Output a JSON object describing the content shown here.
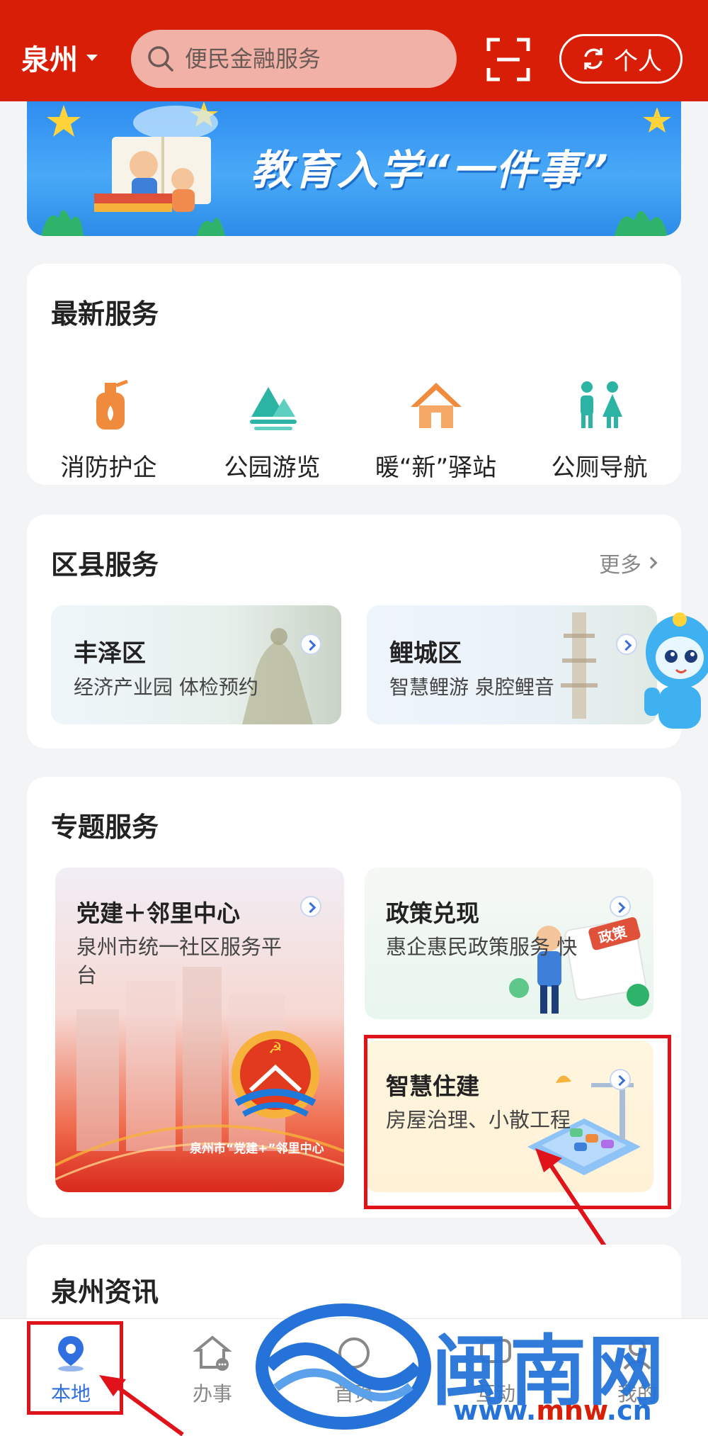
{
  "header": {
    "city": "泉州",
    "search_placeholder": "便民金融服务",
    "personal_label": "个人"
  },
  "banner": {
    "title": "教育入学“一件事”"
  },
  "latest": {
    "title": "最新服务",
    "items": [
      {
        "label": "消防护企",
        "icon": "fire-extinguisher-icon",
        "color": "#f08a3c"
      },
      {
        "label": "公园游览",
        "icon": "mountain-park-icon",
        "color": "#2bb3a4"
      },
      {
        "label": "暖“新”驿站",
        "icon": "house-icon",
        "color": "#f08a3c"
      },
      {
        "label": "公厕导航",
        "icon": "restroom-icon",
        "color": "#2bb3a4"
      }
    ]
  },
  "district": {
    "title": "区县服务",
    "more": "更多",
    "items": [
      {
        "name": "丰泽区",
        "sub": "经济产业园  体检预约"
      },
      {
        "name": "鲤城区",
        "sub": "智慧鲤游 泉腔鲤音"
      }
    ]
  },
  "topic": {
    "title": "专题服务",
    "items": [
      {
        "name": "党建＋邻里中心",
        "sub": "泉州市统一社区服务平台"
      },
      {
        "name": "政策兑现",
        "sub": "惠企惠民政策服务 快"
      },
      {
        "name": "智慧住建",
        "sub": "房屋治理、小散工程"
      }
    ],
    "emblem_text": "泉州市“党建+”邻里中心",
    "policy_sign": "政策"
  },
  "news": {
    "title": "泉州资讯"
  },
  "bottom_nav": {
    "items": [
      {
        "label": "本地",
        "active": true
      },
      {
        "label": "办事",
        "active": false
      },
      {
        "label": "首页",
        "active": false
      },
      {
        "label": "互动",
        "active": false
      },
      {
        "label": "我的",
        "active": false
      }
    ]
  },
  "watermark": {
    "text": "闽南网",
    "url_prefix": "www.",
    "url_brand": "mnw",
    "url_suffix": ".cn"
  },
  "colors": {
    "brand_red": "#d81e06",
    "accent_blue": "#2f6fe0",
    "annotation_red": "#e0131b"
  }
}
